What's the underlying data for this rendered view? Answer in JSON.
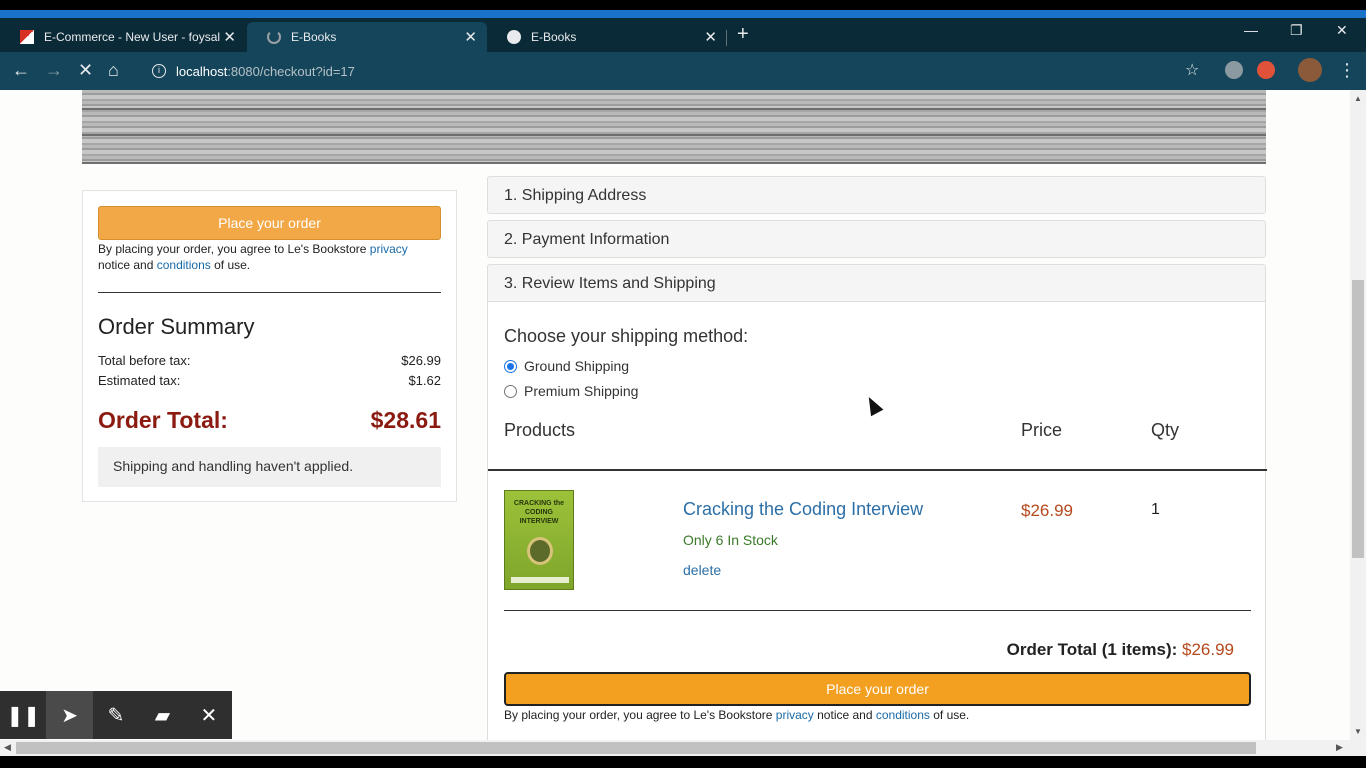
{
  "browser": {
    "tabs": [
      {
        "title": "E-Commerce - New User - foysal",
        "icon": "gmail-icon"
      },
      {
        "title": "E-Books",
        "icon": "loading-icon"
      },
      {
        "title": "E-Books",
        "icon": "globe-icon"
      }
    ],
    "url_host": "localhost",
    "url_path": ":8080/checkout?id=17"
  },
  "summary": {
    "place_order_label": "Place your order",
    "agree_pre": "By placing your order, you agree to Le's Bookstore ",
    "privacy": "privacy",
    "notice_and": " notice and ",
    "conditions": "conditions",
    "of_use": " of use.",
    "title": "Order Summary",
    "before_tax_label": "Total before tax:",
    "before_tax_value": "$26.99",
    "tax_label": "Estimated tax:",
    "tax_value": "$1.62",
    "order_total_label": "Order Total:",
    "order_total_value": "$28.61",
    "shipping_note": "Shipping and handling haven't applied."
  },
  "checkout": {
    "step1": "1. Shipping Address",
    "step2": "2. Payment Information",
    "step3": "3. Review Items and Shipping",
    "choose_method": "Choose your shipping method:",
    "shipping_options": [
      {
        "label": "Ground Shipping",
        "selected": true
      },
      {
        "label": "Premium Shipping",
        "selected": false
      }
    ],
    "col_products": "Products",
    "col_price": "Price",
    "col_qty": "Qty",
    "item": {
      "cover_text": "CRACKING the CODING INTERVIEW",
      "title": "Cracking the Coding Interview",
      "stock": "Only 6 In Stock",
      "delete_label": "delete",
      "price": "$26.99",
      "qty": "1"
    },
    "order_total_label": "Order Total (1 items):",
    "order_total_value": "$26.99",
    "place_order_label": "Place your order"
  },
  "colors": {
    "accent": "#f3a020",
    "total_red": "#8b1a10",
    "price_orange": "#b5481c",
    "link_blue": "#2c6fa6"
  }
}
